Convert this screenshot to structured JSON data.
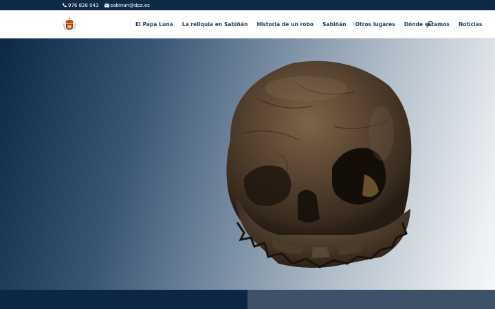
{
  "topbar": {
    "phone": "976 826 043",
    "email": "sabinan@dpz.es"
  },
  "header": {
    "nav": [
      {
        "label": "El Papa Luna"
      },
      {
        "label": "La reliquia en Sabiñán"
      },
      {
        "label": "Historia de un robo"
      },
      {
        "label": "Sabiñán"
      },
      {
        "label": "Otros lugares"
      },
      {
        "label": "Dónde estamos"
      },
      {
        "label": "Noticias"
      }
    ]
  },
  "icons": {
    "phone": "phone-icon",
    "email": "envelope-icon",
    "search": "search-icon",
    "logo": "coat-of-arms-logo"
  },
  "colors": {
    "topbar": "#0f2a47",
    "nav_text": "#1d3d5c",
    "bottom_left": "#0c2745",
    "bottom_right": "#3e5169"
  }
}
